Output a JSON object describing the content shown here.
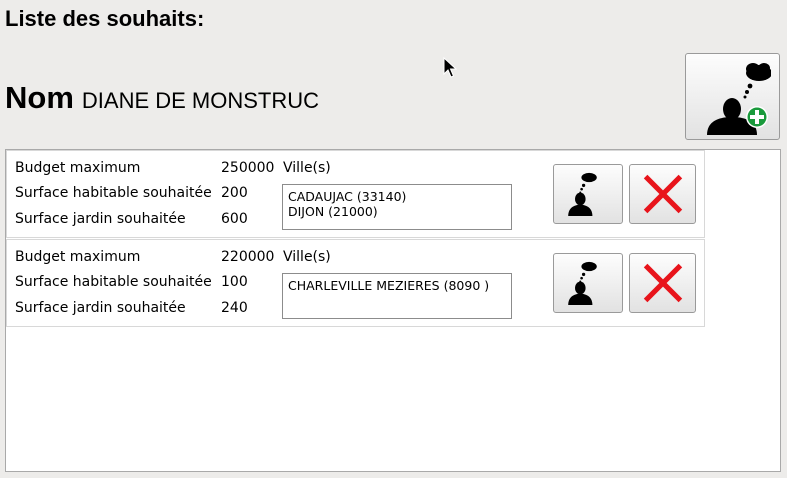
{
  "page": {
    "heading": "Liste des souhaits:",
    "name_label": "Nom",
    "name_value": "DIANE DE MONSTRUC"
  },
  "toolbar": {
    "add_wish_icon": "person-thought-plus-icon"
  },
  "labels": {
    "budget": "Budget maximum",
    "surface_habitable": "Surface habitable souhaitée",
    "surface_jardin": "Surface jardin souhaitée",
    "villes": "Ville(s)"
  },
  "wishes": [
    {
      "budget": "250000",
      "surface_habitable": "200",
      "surface_jardin": "600",
      "cities": [
        "CADAUJAC (33140)",
        "DIJON (21000)"
      ]
    },
    {
      "budget": "220000",
      "surface_habitable": "100",
      "surface_jardin": "240",
      "cities": [
        "CHARLEVILLE MEZIERES (8090 )"
      ]
    }
  ],
  "colors": {
    "delete_red": "#e8141b",
    "add_green": "#1a9a3c"
  }
}
